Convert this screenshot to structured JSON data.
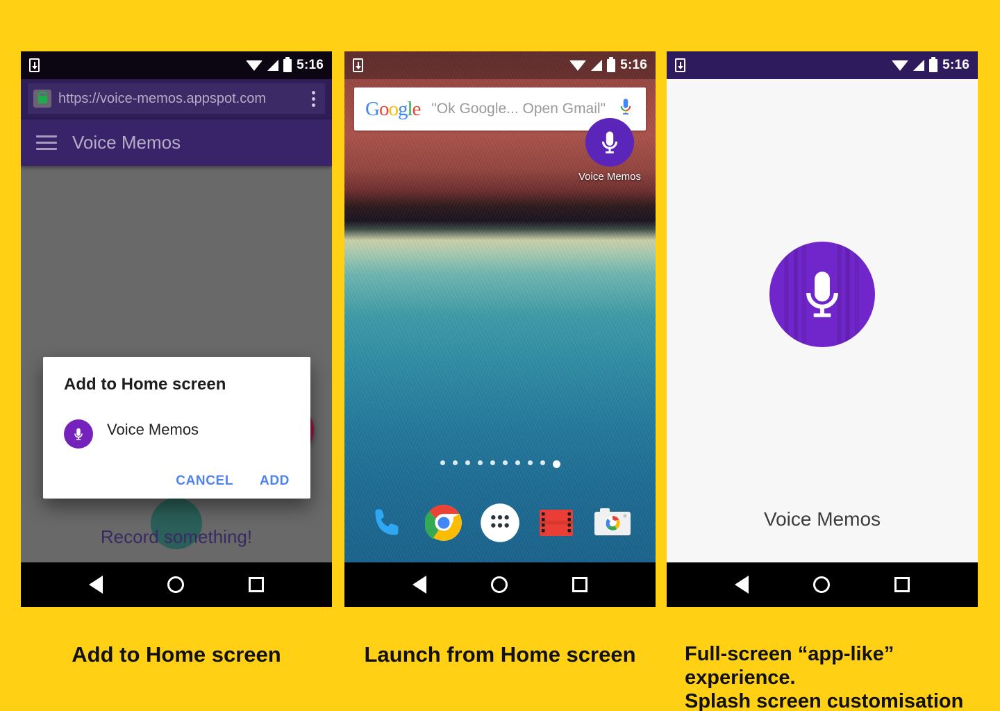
{
  "background_color": "#FFD013",
  "status_bar": {
    "time": "5:16",
    "icons": [
      "download-icon",
      "wifi-icon",
      "signal-icon",
      "battery-icon"
    ]
  },
  "panels": [
    {
      "id": "add-to-home-screen",
      "caption": "Add to Home screen",
      "browser": {
        "url": "https://voice-memos.appspot.com",
        "lock_icon": "lock-icon",
        "menu_icon": "kebab-menu-icon",
        "chrome_color": "#2e1d56",
        "url_bar_color": "#3b2a66"
      },
      "app_bar": {
        "menu_icon": "hamburger-icon",
        "title": "Voice Memos",
        "color": "#3a2469"
      },
      "body": {
        "empty_state_text": "Record something!",
        "fab_icon": "plus-icon",
        "fab_color": "#97123f",
        "scrim_color": "#696969"
      },
      "dialog": {
        "title": "Add to Home screen",
        "app_icon": "microphone-icon",
        "name_value": "Voice Memos",
        "name_placeholder": "Voice Memos",
        "cancel_label": "CANCEL",
        "add_label": "ADD",
        "action_color": "#4d82ef",
        "underline_color": "#4285F4"
      }
    },
    {
      "id": "launch-from-home-screen",
      "caption": "Launch from Home screen",
      "search_widget": {
        "logo": "google-logo",
        "logo_letters": [
          "G",
          "o",
          "o",
          "g",
          "l",
          "e"
        ],
        "hint": "\"Ok Google... Open Gmail\"",
        "mic_icon": "microphone-icon"
      },
      "home_icon": {
        "icon": "microphone-icon",
        "label": "Voice Memos",
        "color": "#5b25ba"
      },
      "page_dots": {
        "count": 10,
        "active_index": 9
      },
      "dock": [
        {
          "name": "phone-icon",
          "label": "Phone"
        },
        {
          "name": "chrome-icon",
          "label": "Chrome"
        },
        {
          "name": "app-drawer-icon",
          "label": "Apps"
        },
        {
          "name": "play-movies-icon",
          "label": "Play Movies"
        },
        {
          "name": "camera-icon",
          "label": "Camera"
        }
      ]
    },
    {
      "id": "splash-screen",
      "caption": "Full-screen “app-like” experience.\nSplash screen customisation",
      "status_bar_color": "#2d1b5e",
      "splash": {
        "background": "#f7f7f7",
        "icon": "microphone-icon",
        "icon_color": "#7126cb",
        "app_name": "Voice Memos"
      }
    }
  ],
  "nav_bar": {
    "back": "back-triangle-icon",
    "home": "home-circle-icon",
    "recents": "recents-square-icon"
  }
}
